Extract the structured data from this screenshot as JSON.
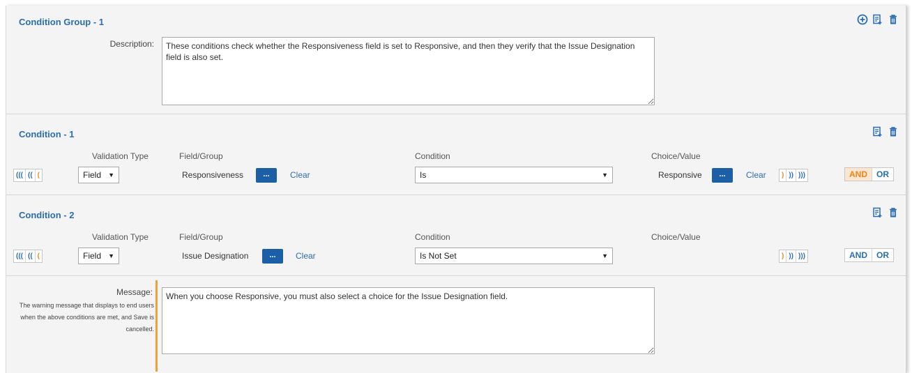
{
  "group": {
    "title": "Condition Group - 1",
    "description_label": "Description:",
    "description_value": "These conditions check whether the Responsiveness field is set to Responsive, and then they verify that the Issue Designation field is also set."
  },
  "headers": {
    "validation_type": "Validation Type",
    "field_group": "Field/Group",
    "condition": "Condition",
    "choice_value": "Choice/Value"
  },
  "paren_open": [
    "(((",
    "((",
    "("
  ],
  "paren_close": [
    ")",
    "))",
    ")))"
  ],
  "conditions": [
    {
      "title": "Condition - 1",
      "validation_type": "Field",
      "field": "Responsiveness",
      "dots_label": "...",
      "clear_label": "Clear",
      "condition": "Is",
      "choice": "Responsive",
      "choice_dots_label": "...",
      "choice_clear_label": "Clear",
      "and_label": "AND",
      "or_label": "OR",
      "active_operator": "AND"
    },
    {
      "title": "Condition - 2",
      "validation_type": "Field",
      "field": "Issue Designation",
      "dots_label": "...",
      "clear_label": "Clear",
      "condition": "Is Not Set",
      "and_label": "AND",
      "or_label": "OR",
      "active_operator": ""
    }
  ],
  "message": {
    "label": "Message:",
    "help_text": "The warning message that displays to end users when the above conditions are met, and Save is cancelled.",
    "value": "When you choose Responsive, you must also select a choice for the Issue Designation field."
  },
  "colors": {
    "accent_blue": "#2a6db5",
    "button_blue": "#1d5fa6",
    "accent_orange": "#f0841c",
    "message_bar": "#f0a03a"
  },
  "icons": [
    "add-circle-icon",
    "edit-doc-icon",
    "trash-icon"
  ]
}
